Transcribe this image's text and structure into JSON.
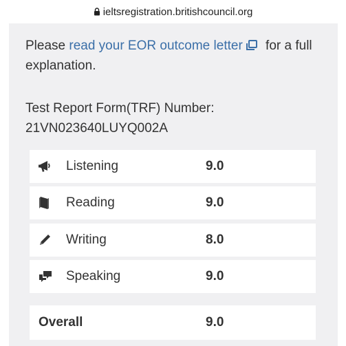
{
  "browser": {
    "url": "ieltsregistration.britishcouncil.org",
    "icon": "lock-icon"
  },
  "intro": {
    "prefix": "Please ",
    "link_text": "read your EOR outcome letter",
    "link_icon": "external-link-icon",
    "suffix": " for a full explanation."
  },
  "trf": {
    "label": "Test Report Form(TRF) Number:",
    "number": "21VN023640LUYQ002A"
  },
  "scores": [
    {
      "icon": "megaphone-icon",
      "label": "Listening",
      "score": "9.0"
    },
    {
      "icon": "book-icon",
      "label": "Reading",
      "score": "9.0"
    },
    {
      "icon": "pencil-icon",
      "label": "Writing",
      "score": "8.0"
    },
    {
      "icon": "speech-bubbles-icon",
      "label": "Speaking",
      "score": "9.0"
    }
  ],
  "overall": {
    "label": "Overall",
    "score": "9.0"
  },
  "colors": {
    "link": "#3b6fa8",
    "panel": "#f0f0f2",
    "text": "#333333"
  }
}
